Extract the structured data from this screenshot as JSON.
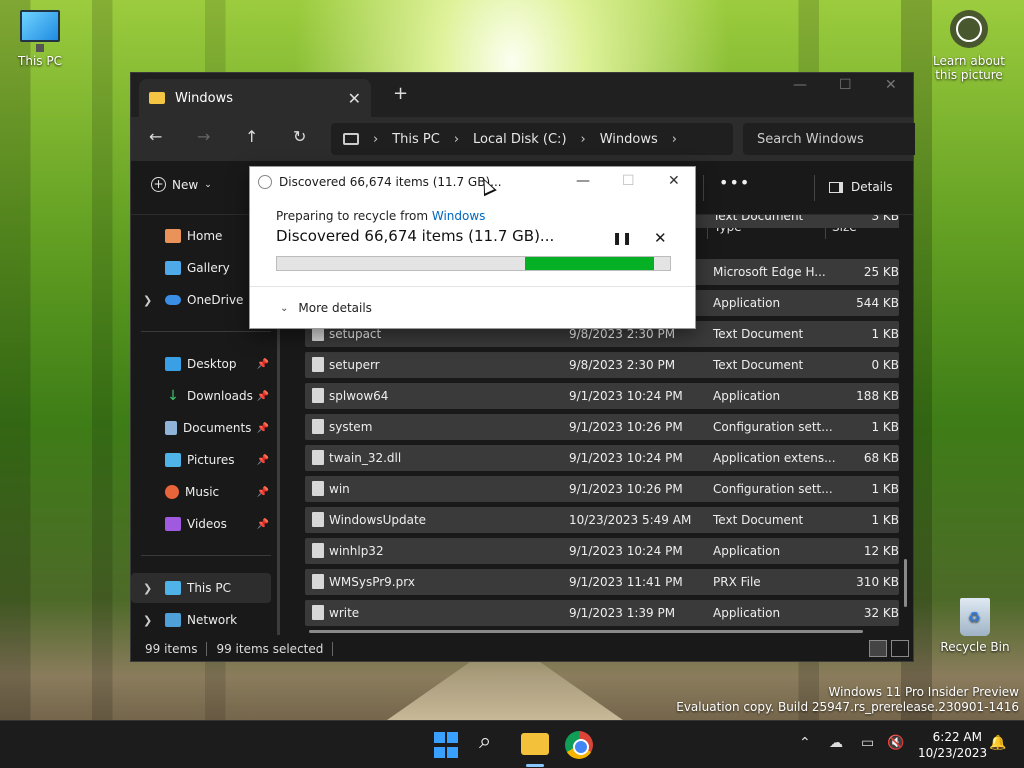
{
  "desktop": {
    "this_pc": "This PC",
    "recycle_bin": "Recycle Bin",
    "learn_line1": "Learn about",
    "learn_line2": "this picture",
    "watermark_line1": "Windows 11 Pro Insider Preview",
    "watermark_line2": "Evaluation copy. Build 25947.rs_prerelease.230901-1416"
  },
  "explorer": {
    "tab_title": "Windows",
    "breadcrumb": [
      "This PC",
      "Local Disk (C:)",
      "Windows"
    ],
    "search_placeholder": "Search Windows",
    "toolbar": {
      "new_label": "New",
      "more_label": "•••",
      "details_label": "Details"
    },
    "sidebar": {
      "home": "Home",
      "gallery": "Gallery",
      "onedrive": "OneDrive",
      "desktop": "Desktop",
      "downloads": "Downloads",
      "documents": "Documents",
      "pictures": "Pictures",
      "music": "Music",
      "videos": "Videos",
      "this_pc": "This PC",
      "network": "Network"
    },
    "columns": {
      "type": "Type",
      "size": "Size"
    },
    "files": [
      {
        "name": "",
        "date": "",
        "type": "Text Document",
        "size": "3 KB"
      },
      {
        "name": "",
        "date": "",
        "type": "Microsoft Edge H...",
        "size": "25 KB"
      },
      {
        "name": "",
        "date": "",
        "type": "Application",
        "size": "544 KB"
      },
      {
        "name": "setupact",
        "date": "9/8/2023 2:30 PM",
        "type": "Text Document",
        "size": "1 KB"
      },
      {
        "name": "setuperr",
        "date": "9/8/2023 2:30 PM",
        "type": "Text Document",
        "size": "0 KB"
      },
      {
        "name": "splwow64",
        "date": "9/1/2023 10:24 PM",
        "type": "Application",
        "size": "188 KB"
      },
      {
        "name": "system",
        "date": "9/1/2023 10:26 PM",
        "type": "Configuration sett...",
        "size": "1 KB"
      },
      {
        "name": "twain_32.dll",
        "date": "9/1/2023 10:24 PM",
        "type": "Application extens...",
        "size": "68 KB"
      },
      {
        "name": "win",
        "date": "9/1/2023 10:26 PM",
        "type": "Configuration sett...",
        "size": "1 KB"
      },
      {
        "name": "WindowsUpdate",
        "date": "10/23/2023 5:49 AM",
        "type": "Text Document",
        "size": "1 KB"
      },
      {
        "name": "winhlp32",
        "date": "9/1/2023 10:24 PM",
        "type": "Application",
        "size": "12 KB"
      },
      {
        "name": "WMSysPr9.prx",
        "date": "9/1/2023 11:41 PM",
        "type": "PRX File",
        "size": "310 KB"
      },
      {
        "name": "write",
        "date": "9/1/2023 1:39 PM",
        "type": "Application",
        "size": "32 KB"
      }
    ],
    "status": {
      "items": "99 items",
      "selected": "99 items selected"
    }
  },
  "dialog": {
    "title": "Discovered 66,674 items (11.7 GB)...",
    "from_prefix": "Preparing to recycle from",
    "from_link": "Windows",
    "status": "Discovered 66,674 items (11.7 GB)...",
    "progress_start": 0.63,
    "progress_end": 0.96,
    "progress_color": "#06b025",
    "more_details": "More details"
  },
  "taskbar": {
    "time": "6:22 AM",
    "date": "10/23/2023"
  }
}
